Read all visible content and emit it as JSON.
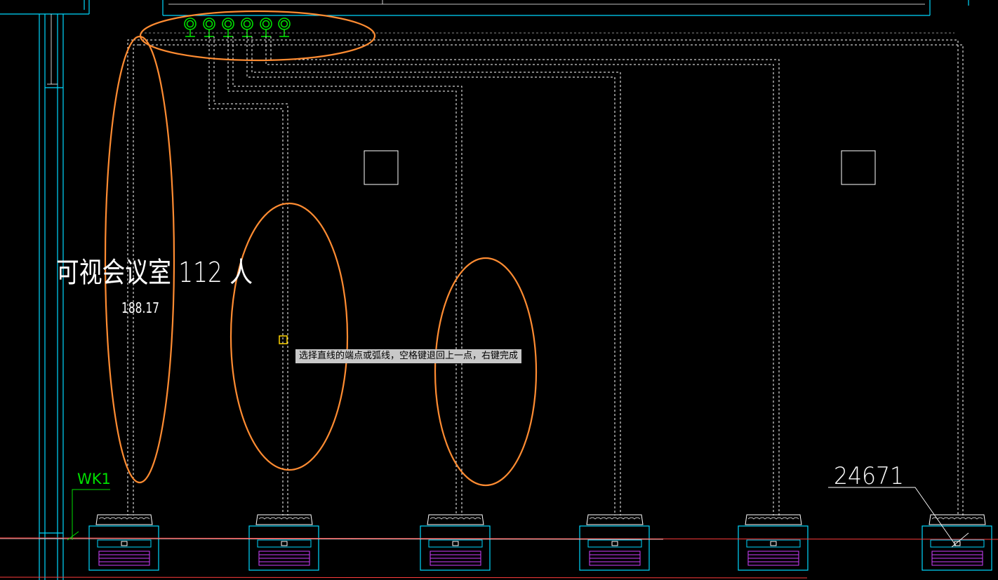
{
  "canvas": {
    "room_name": "可视会议室 112 人",
    "room_area": "188.17",
    "wk_label": "WK1",
    "dimension_label": "24671"
  },
  "tooltip": {
    "prompt": "选择直线的端点或弧线，空格键退回上一点，右键完成"
  },
  "colors": {
    "background": "#000000",
    "pipe": "#ffffff",
    "wall": "#00d8ff",
    "green": "#00e000",
    "annotation": "#ff8c32",
    "section_line": "#ff3c3c",
    "grille": "#d040ff",
    "cursor": "#ffd400",
    "tooltip_bg": "#c8c8c8"
  },
  "icons": {
    "valves": "valve-symbol-icon",
    "cursor": "snap-cursor-icon",
    "units": "fan-coil-unit-icon"
  }
}
